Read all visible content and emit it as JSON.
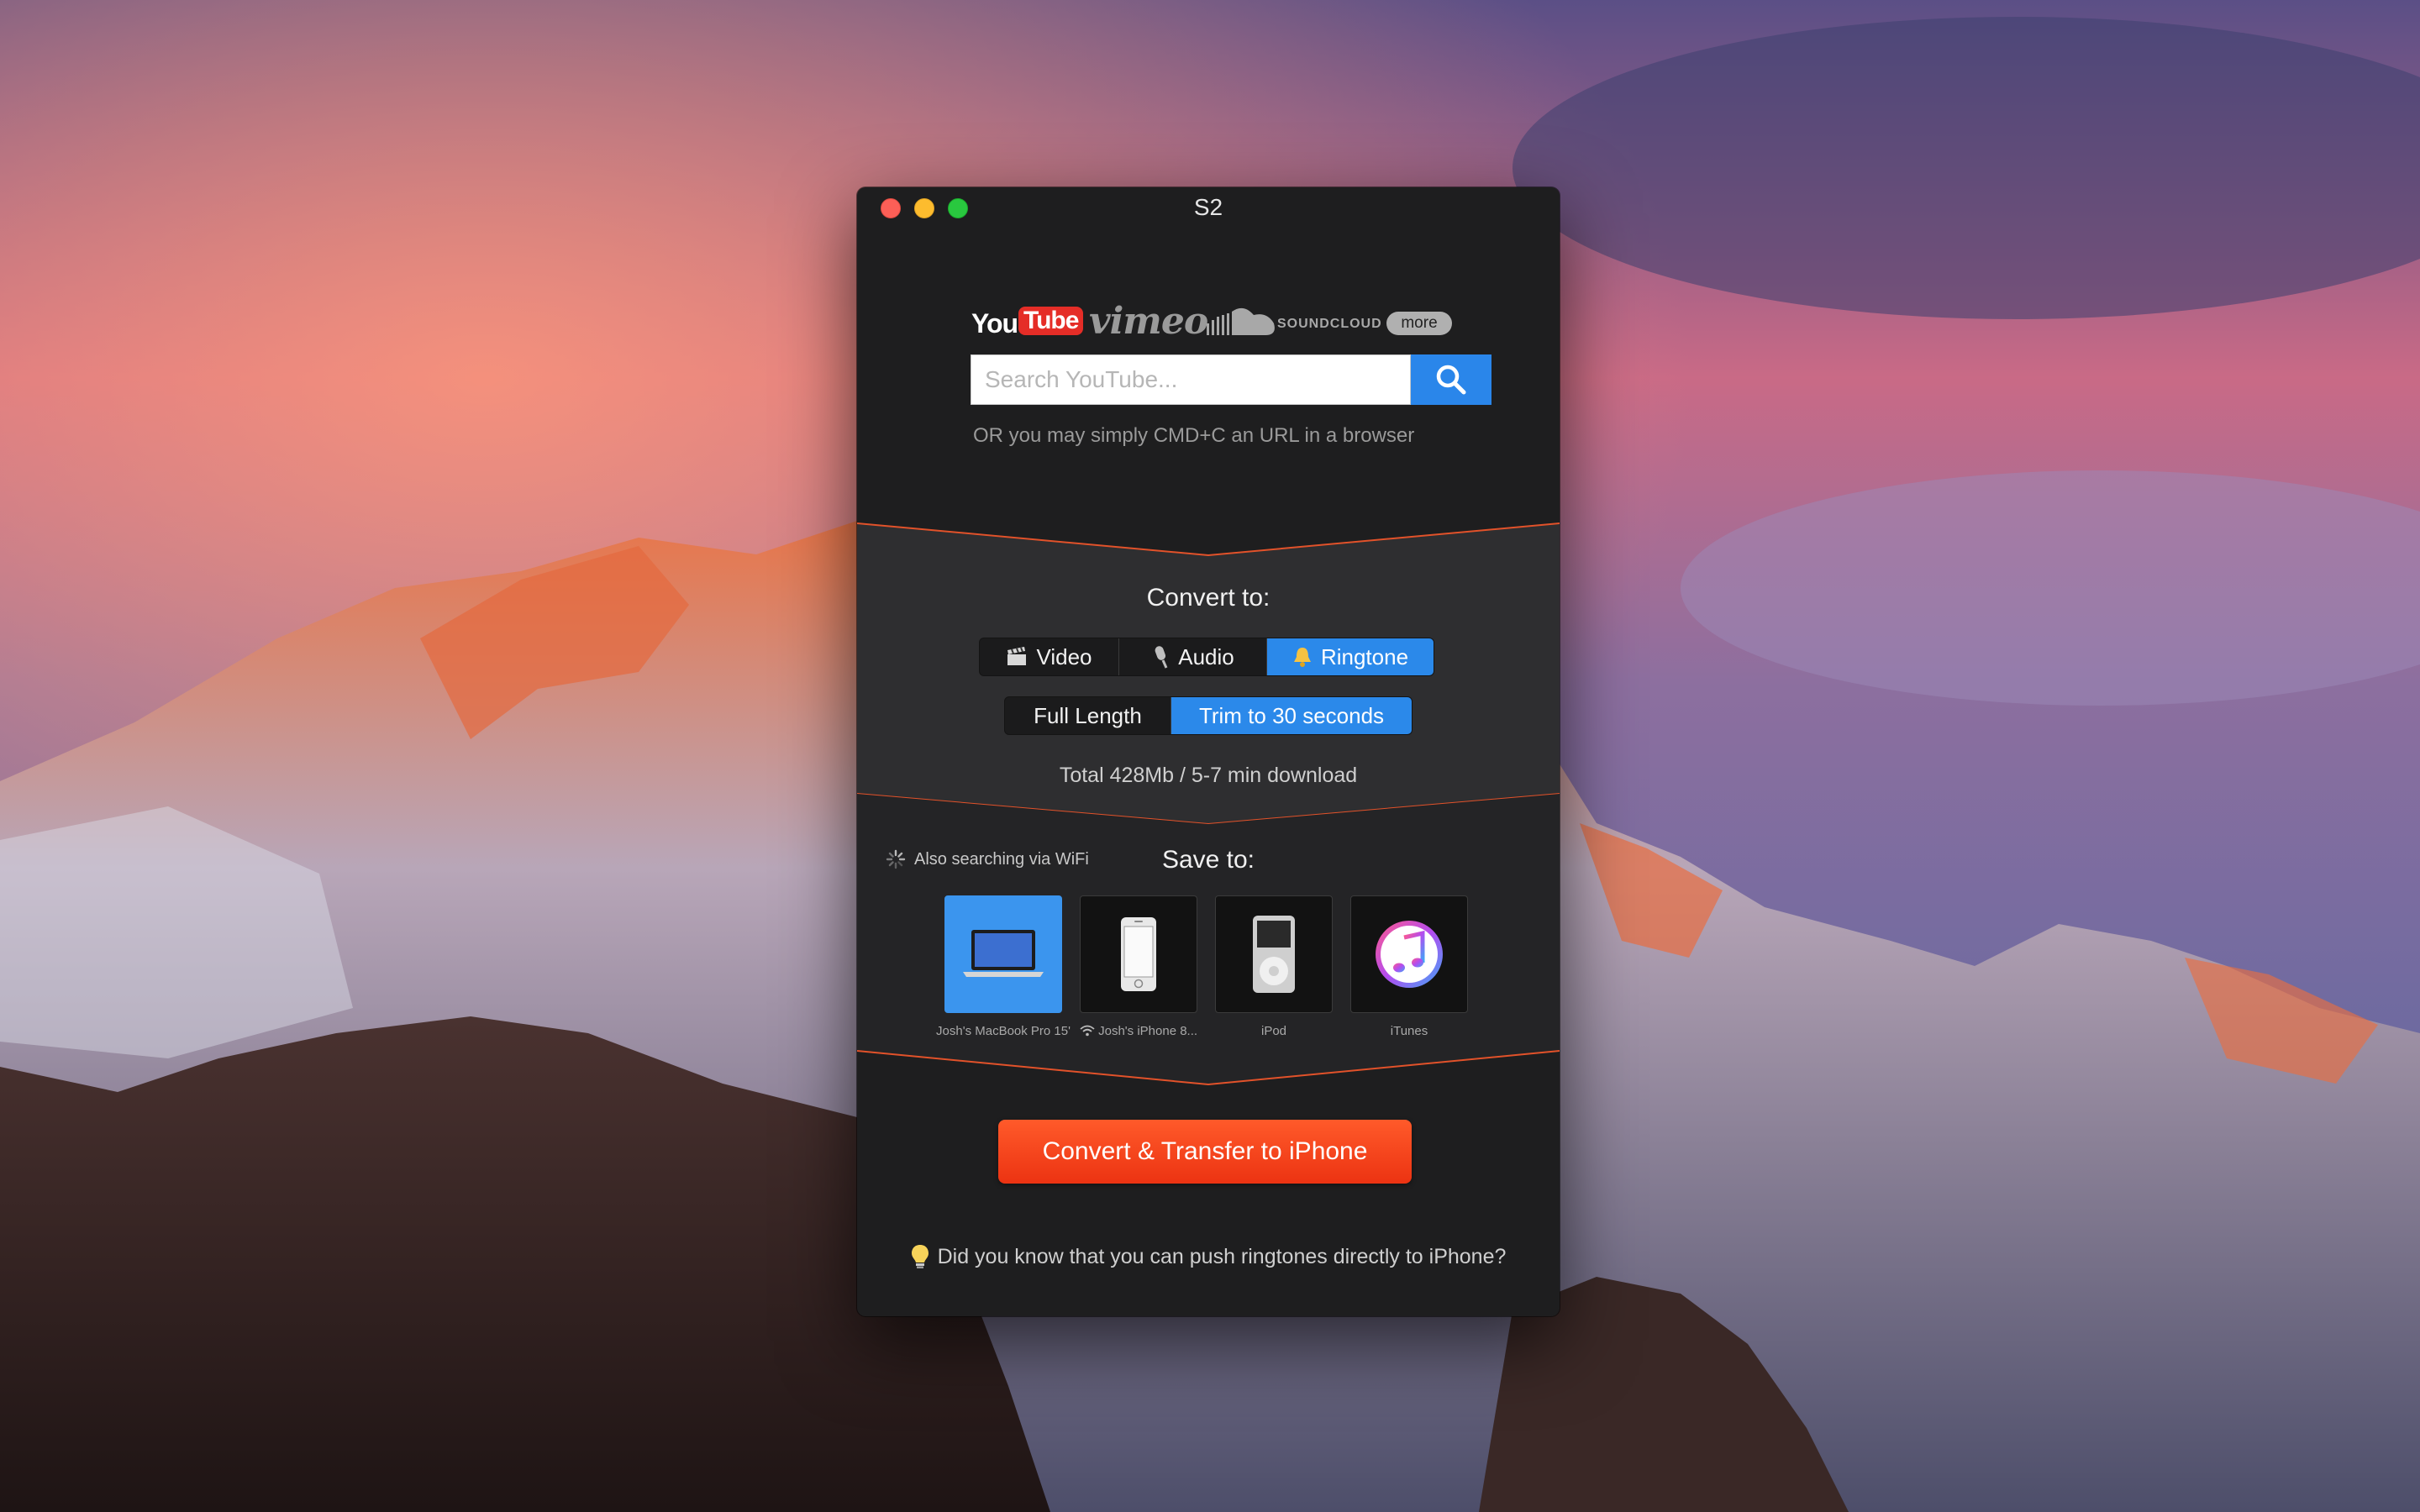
{
  "window": {
    "title": "S2"
  },
  "services": {
    "youtube_you": "You",
    "youtube_tube": "Tube",
    "vimeo": "vimeo",
    "soundcloud": "SOUNDCLOUD",
    "more_label": "more"
  },
  "search": {
    "placeholder": "Search YouTube...",
    "value": "",
    "button_icon": "search-icon"
  },
  "hint": "OR you may simply CMD+C an URL in a browser",
  "convert": {
    "title": "Convert to:",
    "formats": [
      {
        "label": "Video",
        "icon": "clapperboard-icon",
        "active": false
      },
      {
        "label": "Audio",
        "icon": "microphone-icon",
        "active": false
      },
      {
        "label": "Ringtone",
        "icon": "bell-icon",
        "active": true
      }
    ],
    "lengths": [
      {
        "label": "Full Length",
        "active": false
      },
      {
        "label": "Trim to 30 seconds",
        "active": true
      }
    ],
    "total": "Total 428Mb / 5-7 min download"
  },
  "save": {
    "title": "Save to:",
    "wifi_status": "Also searching via WiFi",
    "devices": [
      {
        "label": "Josh's MacBook Pro 15'",
        "icon": "laptop-icon",
        "active": true
      },
      {
        "label": "Josh's iPhone 8...",
        "icon": "iphone-icon",
        "active": false,
        "wifi": true
      },
      {
        "label": "iPod",
        "icon": "ipod-icon",
        "active": false
      },
      {
        "label": "iTunes",
        "icon": "itunes-icon",
        "active": false
      }
    ]
  },
  "cta_label": "Convert & Transfer to iPhone",
  "tip": "Did you know that you can push ringtones directly to iPhone?",
  "colors": {
    "accent_blue": "#2b89ea",
    "cta_orange": "#f0441b",
    "separator": "#e2522a",
    "window_bg": "#1e1e1f",
    "middle_bg": "#2e2e30"
  }
}
